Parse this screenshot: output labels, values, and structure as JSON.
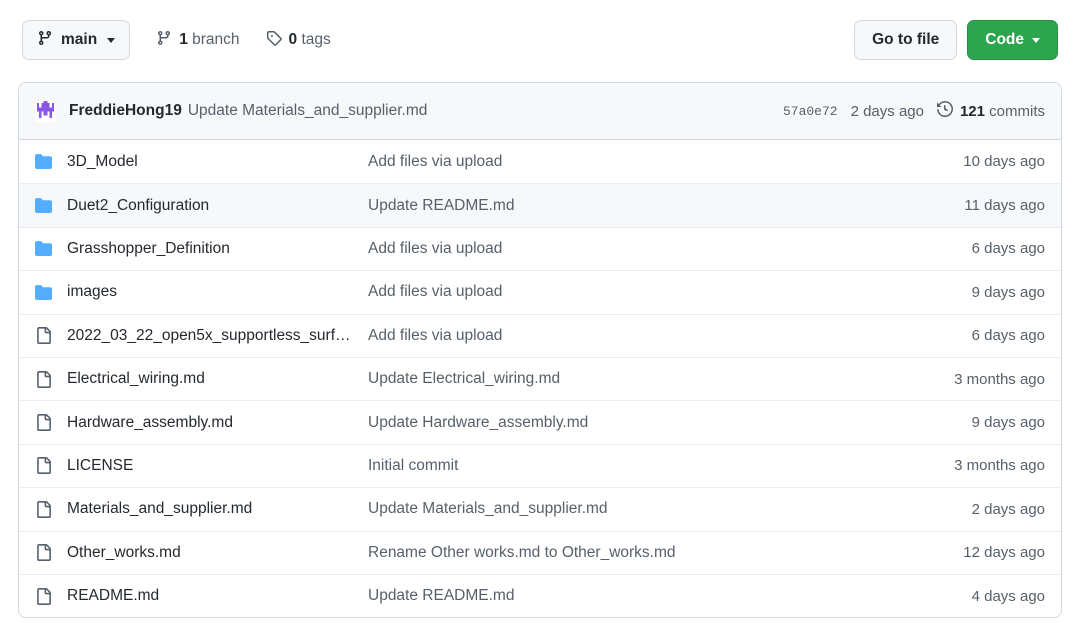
{
  "toolbar": {
    "branch_label": "main",
    "branch_icon": "git-branch-icon",
    "branch_count": "1",
    "branch_word": " branch",
    "tag_count": "0",
    "tag_word": " tags",
    "go_to_file_label": "Go to file",
    "code_label": "Code"
  },
  "commit_header": {
    "author": "FreddieHong19",
    "message": "Update Materials_and_supplier.md",
    "sha": "57a0e72",
    "date": "2 days ago",
    "commits_number": "121",
    "commits_word": " commits",
    "avatar_color": "#8957e5"
  },
  "colors": {
    "accent_green": "#2da44e",
    "folder_blue": "#54aeff",
    "file_gray": "#57606a",
    "border": "#d0d7de",
    "row_hover": "#f6f8fa"
  },
  "files": [
    {
      "type": "folder",
      "name": "3D_Model",
      "message": "Add files via upload",
      "time": "10 days ago",
      "hovered": false
    },
    {
      "type": "folder",
      "name": "Duet2_Configuration",
      "message": "Update README.md",
      "time": "11 days ago",
      "hovered": true
    },
    {
      "type": "folder",
      "name": "Grasshopper_Definition",
      "message": "Add files via upload",
      "time": "6 days ago",
      "hovered": false
    },
    {
      "type": "folder",
      "name": "images",
      "message": "Add files via upload",
      "time": "9 days ago",
      "hovered": false
    },
    {
      "type": "file",
      "name": "2022_03_22_open5x_supportless_surf…",
      "message": "Add files via upload",
      "time": "6 days ago",
      "hovered": false
    },
    {
      "type": "file",
      "name": "Electrical_wiring.md",
      "message": "Update Electrical_wiring.md",
      "time": "3 months ago",
      "hovered": false
    },
    {
      "type": "file",
      "name": "Hardware_assembly.md",
      "message": "Update Hardware_assembly.md",
      "time": "9 days ago",
      "hovered": false
    },
    {
      "type": "file",
      "name": "LICENSE",
      "message": "Initial commit",
      "time": "3 months ago",
      "hovered": false
    },
    {
      "type": "file",
      "name": "Materials_and_supplier.md",
      "message": "Update Materials_and_supplier.md",
      "time": "2 days ago",
      "hovered": false
    },
    {
      "type": "file",
      "name": "Other_works.md",
      "message": "Rename Other works.md to Other_works.md",
      "time": "12 days ago",
      "hovered": false
    },
    {
      "type": "file",
      "name": "README.md",
      "message": "Update README.md",
      "time": "4 days ago",
      "hovered": false
    }
  ]
}
